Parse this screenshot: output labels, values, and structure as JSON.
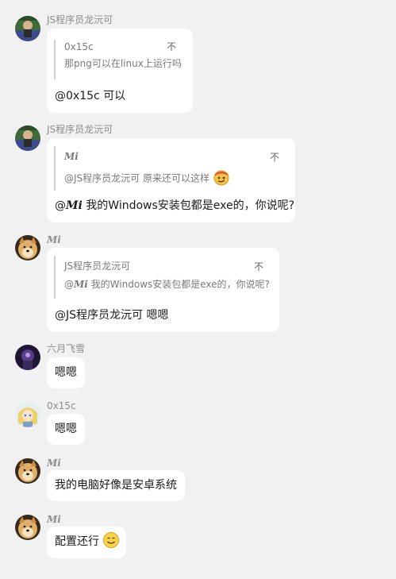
{
  "messages": [
    {
      "sender": "JS程序员龙沅可",
      "quote": {
        "author": "0x15c",
        "text": "那png可以在linux上运行吗",
        "expand_icon": "不"
      },
      "text": "@0x15c 可以"
    },
    {
      "sender": "JS程序员龙沅可",
      "quote": {
        "author": "Mi",
        "text": "@JS程序员龙沅可 原来还可以这样",
        "expand_icon": "不"
      },
      "mention": "@",
      "mention_name": "Mi",
      "text": " 我的Windows安装包都是exe的，你说呢?"
    },
    {
      "sender": "Mi",
      "quote": {
        "author": "JS程序员龙沅可",
        "text_prefix": "@",
        "text_name": "Mi",
        "text": " 我的Windows安装包都是exe的，你说呢?",
        "expand_icon": "不"
      },
      "text": "@JS程序员龙沅可 嗯嗯"
    },
    {
      "sender": "六月飞雪",
      "text": "嗯嗯"
    },
    {
      "sender": "0x15c",
      "text": "嗯嗯"
    },
    {
      "sender": "Mi",
      "text": "我的电脑好像是安卓系统"
    },
    {
      "sender": "Mi",
      "text": "配置还行"
    }
  ],
  "colors": {
    "background": "#f1f1f1",
    "bubble": "#ffffff",
    "sender": "#8c8c8c",
    "quote_bar": "#d2d2d2"
  },
  "icons": [
    "avatar-js",
    "avatar-doge",
    "avatar-snow",
    "avatar-anime",
    "smirk-emoji",
    "smile-emoji"
  ]
}
